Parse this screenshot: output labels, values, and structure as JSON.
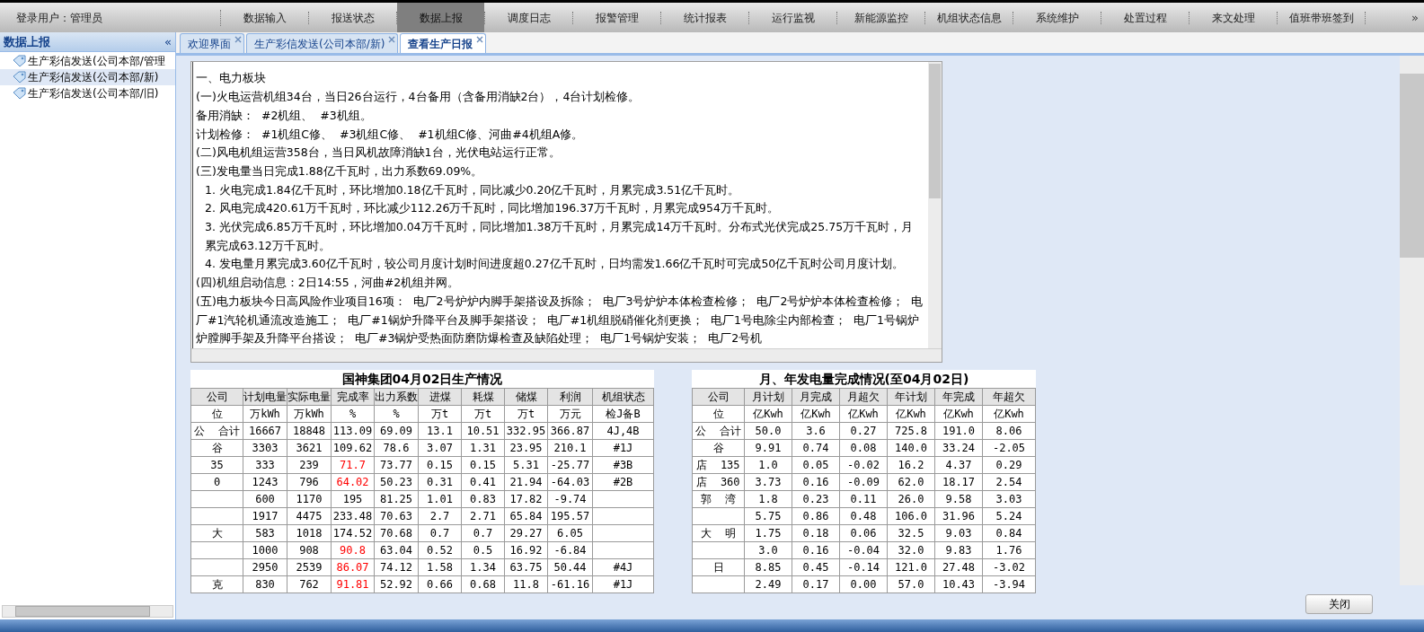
{
  "login": "登录用户：管理员",
  "nav": [
    {
      "label": "数据输入",
      "selected": false
    },
    {
      "label": "报送状态",
      "selected": false
    },
    {
      "label": "数据上报",
      "selected": true
    },
    {
      "label": "调度日志",
      "selected": false
    },
    {
      "label": "报警管理",
      "selected": false
    },
    {
      "label": "统计报表",
      "selected": false
    },
    {
      "label": "运行监视",
      "selected": false
    },
    {
      "label": "新能源监控",
      "selected": false
    },
    {
      "label": "机组状态信息",
      "selected": false
    },
    {
      "label": "系统维护",
      "selected": false
    },
    {
      "label": "处置过程",
      "selected": false
    },
    {
      "label": "来文处理",
      "selected": false
    },
    {
      "label": "值班带班签到",
      "selected": false
    }
  ],
  "nav_more": "»",
  "sidebar": {
    "title": "数据上报",
    "collapse": "«",
    "items": [
      {
        "label": "生产彩信发送(公司本部/管理",
        "selected": false
      },
      {
        "label": "生产彩信发送(公司本部/新)",
        "selected": true
      },
      {
        "label": "生产彩信发送(公司本部/旧)",
        "selected": false
      }
    ]
  },
  "tabs": [
    {
      "label": "欢迎界面",
      "selected": false
    },
    {
      "label": "生产彩信发送(公司本部/新)",
      "selected": false
    },
    {
      "label": "查看生产日报",
      "selected": true
    }
  ],
  "report_lines": [
    {
      "kind": "blank"
    },
    {
      "kind": "line",
      "text": "一、电力板块"
    },
    {
      "kind": "line",
      "text": "(一)火电运营机组34台，当日26台运行，4台备用（含备用消缺2台），4台计划检修。"
    },
    {
      "kind": "line",
      "text": "备用消缺：  #2机组、  #3机组。"
    },
    {
      "kind": "line",
      "text": "计划检修：  #1机组C修、  #3机组C修、  #1机组C修、河曲#4机组A修。"
    },
    {
      "kind": "line",
      "text": "(二)风电机组运营358台，当日风机故障消缺1台，光伏电站运行正常。"
    },
    {
      "kind": "line",
      "text": "(三)发电量当日完成1.88亿千瓦时，出力系数69.09%。"
    },
    {
      "kind": "item",
      "text": "1. 火电完成1.84亿千瓦时，环比增加0.18亿千瓦时，同比减少0.20亿千瓦时，月累完成3.51亿千瓦时。"
    },
    {
      "kind": "item",
      "text": "2. 风电完成420.61万千瓦时，环比减少112.26万千瓦时，同比增加196.37万千瓦时，月累完成954万千瓦时。"
    },
    {
      "kind": "item",
      "text": "3. 光伏完成6.85万千瓦时，环比增加0.04万千瓦时，同比增加1.38万千瓦时，月累完成14万千瓦时。分布式光伏完成25.75万千瓦时，月累完成63.12万千瓦时。"
    },
    {
      "kind": "item",
      "text": "4. 发电量月累完成3.60亿千瓦时，较公司月度计划时间进度超0.27亿千瓦时，日均需发1.66亿千瓦时可完成50亿千瓦时公司月度计划。"
    },
    {
      "kind": "line",
      "text": "(四)机组启动信息：2日14:55，河曲#2机组并网。"
    },
    {
      "kind": "line",
      "text": "(五)电力板块今日高风险作业项目16项：  电厂2号炉炉内脚手架搭设及拆除；  电厂3号炉炉本体检查检修；  电厂2号炉炉本体检查检修；  电厂#1汽轮机通流改造施工；  电厂#1锅炉升降平台及脚手架搭设；  电厂#1机组脱硝催化剂更换；  电厂1号电除尘内部检查；  电厂1号锅炉炉膛脚手架及升降平台搭设；  电厂#3锅炉受热面防磨防爆检查及缺陷处理；  电厂1号锅炉安装；  电厂2号机"
    }
  ],
  "table_production": {
    "title": "国神集团04月02日生产情况",
    "columns": [
      "公司",
      "计划电量",
      "实际电量",
      "完成率",
      "出力系数",
      "进煤",
      "耗煤",
      "储煤",
      "利润",
      "机组状态"
    ],
    "units": [
      "位",
      "万kWh",
      "万kWh",
      "%",
      "%",
      "万t",
      "万t",
      "万t",
      "万元",
      "检J备B"
    ],
    "rows": [
      {
        "company": "公  合计",
        "values": [
          "16667",
          "18848",
          "113.09",
          "69.09",
          "13.1",
          "10.51",
          "332.95",
          "366.87"
        ],
        "unit_status": "4J,4B",
        "rate_below_plan": false
      },
      {
        "company": "谷",
        "values": [
          "3303",
          "3621",
          "109.62",
          "78.6",
          "3.07",
          "1.31",
          "23.95",
          "210.1"
        ],
        "unit_status": "#1J",
        "rate_below_plan": false
      },
      {
        "company": "35",
        "values": [
          "333",
          "239",
          "71.7",
          "73.77",
          "0.15",
          "0.15",
          "5.31",
          "-25.77"
        ],
        "unit_status": "#3B",
        "rate_below_plan": true
      },
      {
        "company": "0",
        "values": [
          "1243",
          "796",
          "64.02",
          "50.23",
          "0.31",
          "0.41",
          "21.94",
          "-64.03"
        ],
        "unit_status": "#2B",
        "rate_below_plan": true
      },
      {
        "company": null,
        "values": [
          "600",
          "1170",
          "195",
          "81.25",
          "1.01",
          "0.83",
          "17.82",
          "-9.74"
        ],
        "rate_below_plan": false
      },
      {
        "company": null,
        "values": [
          "1917",
          "4475",
          "233.48",
          "70.63",
          "2.7",
          "2.71",
          "65.84",
          "195.57"
        ],
        "rate_below_plan": false
      },
      {
        "company": "大",
        "values": [
          "583",
          "1018",
          "174.52",
          "70.68",
          "0.7",
          "0.7",
          "29.27",
          "6.05"
        ],
        "rate_below_plan": false
      },
      {
        "company": null,
        "values": [
          "1000",
          "908",
          "90.8",
          "63.04",
          "0.52",
          "0.5",
          "16.92",
          "-6.84"
        ],
        "rate_below_plan": true
      },
      {
        "company": null,
        "values": [
          "2950",
          "2539",
          "86.07",
          "74.12",
          "1.58",
          "1.34",
          "63.75",
          "50.44"
        ],
        "unit_status": "#4J",
        "rate_below_plan": true
      },
      {
        "company": "克",
        "values": [
          "830",
          "762",
          "91.81",
          "52.92",
          "0.66",
          "0.68",
          "11.8",
          "-61.16"
        ],
        "unit_status": "#1J",
        "rate_below_plan": true
      }
    ]
  },
  "table_generation": {
    "title": "月、年发电量完成情况(至04月02日)",
    "columns": [
      "公司",
      "月计划",
      "月完成",
      "月超欠",
      "年计划",
      "年完成",
      "年超欠"
    ],
    "units": [
      "位",
      "亿Kwh",
      "亿Kwh",
      "亿Kwh",
      "亿Kwh",
      "亿Kwh",
      "亿Kwh"
    ],
    "rows": [
      {
        "company": "公  合计",
        "values": [
          "50.0",
          "3.6",
          "0.27",
          "725.8",
          "191.0",
          "8.06"
        ]
      },
      {
        "company": "谷",
        "values": [
          "9.91",
          "0.74",
          "0.08",
          "140.0",
          "33.24",
          "-2.05"
        ]
      },
      {
        "company": "店  135",
        "values": [
          "1.0",
          "0.05",
          "-0.02",
          "16.2",
          "4.37",
          "0.29"
        ]
      },
      {
        "company": "店  360",
        "values": [
          "3.73",
          "0.16",
          "-0.09",
          "62.0",
          "18.17",
          "2.54"
        ]
      },
      {
        "company": "郭  湾",
        "values": [
          "1.8",
          "0.23",
          "0.11",
          "26.0",
          "9.58",
          "3.03"
        ]
      },
      {
        "company": null,
        "values": [
          "5.75",
          "0.86",
          "0.48",
          "106.0",
          "31.96",
          "5.24"
        ]
      },
      {
        "company": "大  明",
        "values": [
          "1.75",
          "0.18",
          "0.06",
          "32.5",
          "9.03",
          "0.84"
        ]
      },
      {
        "company": null,
        "values": [
          "3.0",
          "0.16",
          "-0.04",
          "32.0",
          "9.83",
          "1.76"
        ]
      },
      {
        "company": "日",
        "values": [
          "8.85",
          "0.45",
          "-0.14",
          "121.0",
          "27.48",
          "-3.02"
        ]
      },
      {
        "company": null,
        "values": [
          "2.49",
          "0.17",
          "0.00",
          "57.0",
          "10.43",
          "-3.94"
        ]
      }
    ]
  },
  "close_button": "关闭"
}
